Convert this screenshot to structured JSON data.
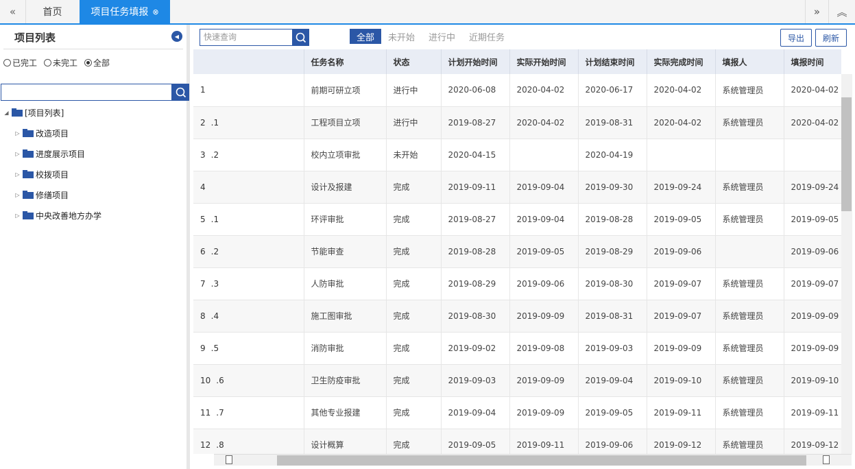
{
  "tabs": {
    "left_icon": "«",
    "items": [
      {
        "label": "首页"
      },
      {
        "label": "项目任务填报",
        "close": "⊗"
      }
    ],
    "right_icons": [
      "»",
      "︽"
    ]
  },
  "sidebar": {
    "title": "项目列表",
    "collapse_icon": "◀",
    "filters": [
      "已完工",
      "未完工",
      "全部"
    ],
    "selected_filter": "全部",
    "search_placeholder": "",
    "tree": {
      "root": "[项目列表]",
      "children": [
        "改造项目",
        "进度展示项目",
        "校拨项目",
        "修缮项目",
        "中央改善地方办学"
      ]
    }
  },
  "toolbar": {
    "search_placeholder": "快速查询",
    "filters": [
      "全部",
      "未开始",
      "进行中",
      "近期任务"
    ],
    "active_filter": "全部",
    "export_label": "导出",
    "refresh_label": "刷新"
  },
  "table": {
    "columns": [
      "",
      "任务名称",
      "状态",
      "计划开始时间",
      "实际开始时间",
      "计划结束时间",
      "实际完成时间",
      "填报人",
      "填报时间"
    ],
    "rows": [
      {
        "no": "1",
        "sub": "",
        "name": "前期可研立项",
        "status": "进行中",
        "plan_start": "2020-06-08",
        "actual_start": "2020-04-02",
        "plan_end": "2020-06-17",
        "actual_end": "2020-04-02",
        "reporter": "系统管理员",
        "report_time": "2020-04-02"
      },
      {
        "no": "2",
        "sub": ".1",
        "name": "工程项目立项",
        "status": "进行中",
        "plan_start": "2019-08-27",
        "actual_start": "2020-04-02",
        "plan_end": "2019-08-31",
        "actual_end": "2020-04-02",
        "reporter": "系统管理员",
        "report_time": "2020-04-02"
      },
      {
        "no": "3",
        "sub": ".2",
        "name": "校内立项审批",
        "status": "未开始",
        "plan_start": "2020-04-15",
        "actual_start": "",
        "plan_end": "2020-04-19",
        "actual_end": "",
        "reporter": "",
        "report_time": ""
      },
      {
        "no": "4",
        "sub": "",
        "name": "设计及报建",
        "status": "完成",
        "plan_start": "2019-09-11",
        "actual_start": "2019-09-04",
        "plan_end": "2019-09-30",
        "actual_end": "2019-09-24",
        "reporter": "系统管理员",
        "report_time": "2019-09-24"
      },
      {
        "no": "5",
        "sub": ".1",
        "name": "环评审批",
        "status": "完成",
        "plan_start": "2019-08-27",
        "actual_start": "2019-09-04",
        "plan_end": "2019-08-28",
        "actual_end": "2019-09-05",
        "reporter": "系统管理员",
        "report_time": "2019-09-05"
      },
      {
        "no": "6",
        "sub": ".2",
        "name": "节能审查",
        "status": "完成",
        "plan_start": "2019-08-28",
        "actual_start": "2019-09-05",
        "plan_end": "2019-08-29",
        "actual_end": "2019-09-06",
        "reporter": "",
        "report_time": "2019-09-06"
      },
      {
        "no": "7",
        "sub": ".3",
        "name": "人防审批",
        "status": "完成",
        "plan_start": "2019-08-29",
        "actual_start": "2019-09-06",
        "plan_end": "2019-08-30",
        "actual_end": "2019-09-07",
        "reporter": "系统管理员",
        "report_time": "2019-09-07"
      },
      {
        "no": "8",
        "sub": ".4",
        "name": "施工图审批",
        "status": "完成",
        "plan_start": "2019-08-30",
        "actual_start": "2019-09-09",
        "plan_end": "2019-08-31",
        "actual_end": "2019-09-07",
        "reporter": "系统管理员",
        "report_time": "2019-09-09"
      },
      {
        "no": "9",
        "sub": ".5",
        "name": "消防审批",
        "status": "完成",
        "plan_start": "2019-09-02",
        "actual_start": "2019-09-08",
        "plan_end": "2019-09-03",
        "actual_end": "2019-09-09",
        "reporter": "系统管理员",
        "report_time": "2019-09-09"
      },
      {
        "no": "10",
        "sub": ".6",
        "name": "卫生防疫审批",
        "status": "完成",
        "plan_start": "2019-09-03",
        "actual_start": "2019-09-09",
        "plan_end": "2019-09-04",
        "actual_end": "2019-09-10",
        "reporter": "系统管理员",
        "report_time": "2019-09-10"
      },
      {
        "no": "11",
        "sub": ".7",
        "name": "其他专业报建",
        "status": "完成",
        "plan_start": "2019-09-04",
        "actual_start": "2019-09-09",
        "plan_end": "2019-09-05",
        "actual_end": "2019-09-11",
        "reporter": "系统管理员",
        "report_time": "2019-09-11"
      },
      {
        "no": "12",
        "sub": ".8",
        "name": "设计概算",
        "status": "完成",
        "plan_start": "2019-09-05",
        "actual_start": "2019-09-11",
        "plan_end": "2019-09-06",
        "actual_end": "2019-09-12",
        "reporter": "系统管理员",
        "report_time": "2019-09-12"
      }
    ]
  },
  "colors": {
    "accent": "#1e88e5",
    "primary": "#2b57a6",
    "header_bg": "#e9edf5"
  }
}
